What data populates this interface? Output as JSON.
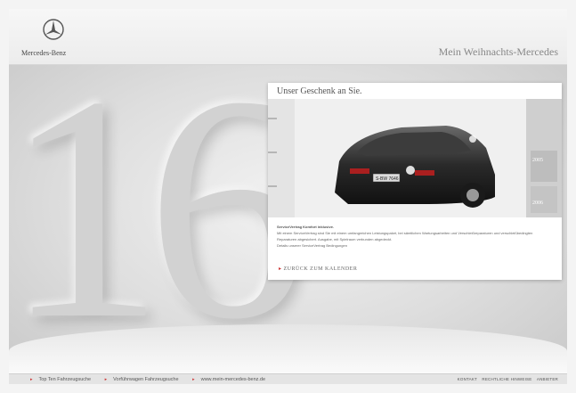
{
  "header": {
    "brand": "Mercedes-Benz",
    "title": "Mein Weihnachts-Mercedes"
  },
  "stage": {
    "day_number": "16"
  },
  "panel": {
    "title": "Unser Geschenk an Sie.",
    "plate": "S-BW 7646",
    "years": [
      "2005",
      "2006"
    ],
    "text_heading": "ServiceVertrag Komfort inklusive.",
    "text_body": "Mit einem ServiceVertrag sind Sie mit einem umfangreichen Leistungspaket, bei sämtlichen Wartungsarbeiten und Verschleißreparaturen und verschleißbedingten Reparaturen abgesichert. Ausgabe, mit Spielraum verbunden abgedeckt.",
    "text_link": "Details unserer ServiceVertrag Bedingungen",
    "back_link": "ZURÜCK ZUM KALENDER"
  },
  "footer": {
    "links": [
      "Top Ten Fahrzeugsuche",
      "Vorführwagen Fahrzeugsuche",
      "www.mein-mercedes-benz.de"
    ],
    "right_links": [
      "KONTAKT",
      "RECHTLICHE HINWEISE",
      "ANBIETER"
    ]
  },
  "colors": {
    "accent": "#cc3333",
    "background": "#e9e9e9"
  },
  "icons": {
    "logo": "mercedes-star-icon",
    "link_arrow": "triangle-right-icon"
  }
}
